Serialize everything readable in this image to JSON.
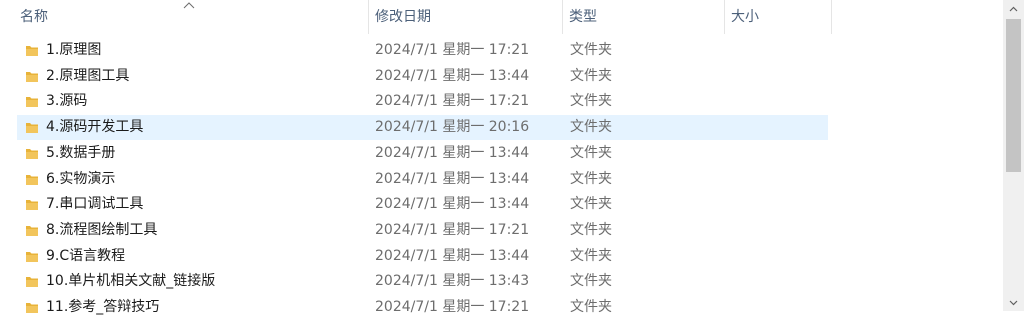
{
  "columns": {
    "name": "名称",
    "date": "修改日期",
    "type": "类型",
    "size": "大小"
  },
  "rows": [
    {
      "name": "1.原理图",
      "date": "2024/7/1 星期一 17:21",
      "type": "文件夹",
      "icon": "folder-icon"
    },
    {
      "name": "2.原理图工具",
      "date": "2024/7/1 星期一 13:44",
      "type": "文件夹",
      "icon": "folder-icon"
    },
    {
      "name": "3.源码",
      "date": "2024/7/1 星期一 17:21",
      "type": "文件夹",
      "icon": "folder-icon"
    },
    {
      "name": "4.源码开发工具",
      "date": "2024/7/1 星期一 20:16",
      "type": "文件夹",
      "icon": "folder-icon",
      "selected": true
    },
    {
      "name": "5.数据手册",
      "date": "2024/7/1 星期一 13:44",
      "type": "文件夹",
      "icon": "folder-icon"
    },
    {
      "name": "6.实物演示",
      "date": "2024/7/1 星期一 13:44",
      "type": "文件夹",
      "icon": "folder-icon"
    },
    {
      "name": "7.串口调试工具",
      "date": "2024/7/1 星期一 13:44",
      "type": "文件夹",
      "icon": "folder-icon"
    },
    {
      "name": "8.流程图绘制工具",
      "date": "2024/7/1 星期一 17:21",
      "type": "文件夹",
      "icon": "folder-icon"
    },
    {
      "name": "9.C语言教程",
      "date": "2024/7/1 星期一 13:44",
      "type": "文件夹",
      "icon": "folder-icon"
    },
    {
      "name": "10.单片机相关文献_链接版",
      "date": "2024/7/1 星期一 13:43",
      "type": "文件夹",
      "icon": "folder-icon"
    },
    {
      "name": "11.参考_答辩技巧",
      "date": "2024/7/1 星期一 17:21",
      "type": "文件夹",
      "icon": "folder-icon"
    }
  ],
  "colors": {
    "selected_row": "#e5f3ff",
    "folder": "#f2c55c",
    "header_text": "#4c607a"
  }
}
